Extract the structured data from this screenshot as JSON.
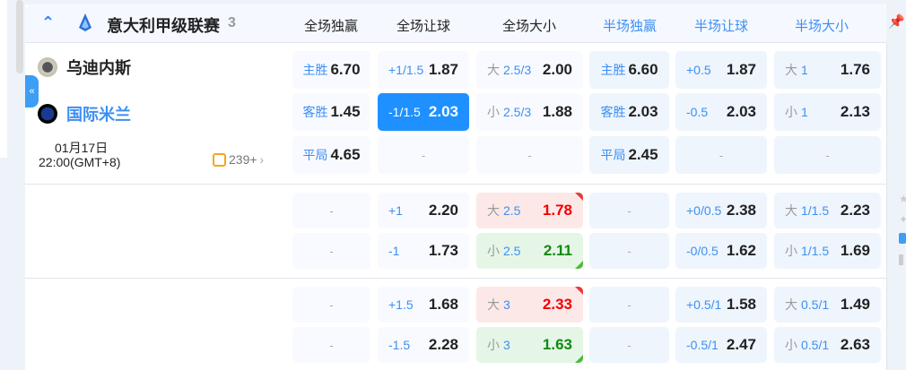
{
  "league": {
    "name": "意大利甲级联赛",
    "count": "3"
  },
  "columns": [
    "全场独赢",
    "全场让球",
    "全场大小",
    "半场独赢",
    "半场让球",
    "半场大小"
  ],
  "match": {
    "home": "乌迪内斯",
    "away": "国际米兰",
    "date": "01月17日",
    "time": "22:00(GMT+8)",
    "more_bets": "239+"
  },
  "colors": {
    "accent": "#3d8ff2",
    "selected": "#1e90ff",
    "odds_up": "#f20000",
    "odds_down": "#118a11"
  },
  "sections": [
    [
      [
        {
          "label": "主胜",
          "odds": "6.70"
        },
        {
          "line": "+1/1.5",
          "odds": "1.87"
        },
        {
          "ou": "大",
          "line": "2.5/3",
          "odds": "2.00"
        },
        {
          "label": "主胜",
          "odds": "6.60"
        },
        {
          "line": "+0.5",
          "odds": "1.87"
        },
        {
          "ou": "大",
          "line": "1",
          "odds": "1.76"
        }
      ],
      [
        {
          "label": "客胜",
          "odds": "1.45"
        },
        {
          "line": "-1/1.5",
          "odds": "2.03",
          "state": "selected"
        },
        {
          "ou": "小",
          "line": "2.5/3",
          "odds": "1.88"
        },
        {
          "label": "客胜",
          "odds": "2.03"
        },
        {
          "line": "-0.5",
          "odds": "2.03"
        },
        {
          "ou": "小",
          "line": "1",
          "odds": "2.13"
        }
      ],
      [
        {
          "label": "平局",
          "odds": "4.65"
        },
        {
          "empty": "-"
        },
        {
          "empty": "-"
        },
        {
          "label": "平局",
          "odds": "2.45"
        },
        {
          "empty": "-"
        },
        {
          "empty": "-"
        }
      ]
    ],
    [
      [
        {
          "empty": "-"
        },
        {
          "line": "+1",
          "odds": "2.20"
        },
        {
          "ou": "大",
          "line": "2.5",
          "odds": "1.78",
          "state": "up"
        },
        {
          "empty": "-"
        },
        {
          "line": "+0/0.5",
          "odds": "2.38"
        },
        {
          "ou": "大",
          "line": "1/1.5",
          "odds": "2.23"
        }
      ],
      [
        {
          "empty": "-"
        },
        {
          "line": "-1",
          "odds": "1.73"
        },
        {
          "ou": "小",
          "line": "2.5",
          "odds": "2.11",
          "state": "down"
        },
        {
          "empty": "-"
        },
        {
          "line": "-0/0.5",
          "odds": "1.62"
        },
        {
          "ou": "小",
          "line": "1/1.5",
          "odds": "1.69"
        }
      ]
    ],
    [
      [
        {
          "empty": "-"
        },
        {
          "line": "+1.5",
          "odds": "1.68"
        },
        {
          "ou": "大",
          "line": "3",
          "odds": "2.33",
          "state": "up"
        },
        {
          "empty": "-"
        },
        {
          "line": "+0.5/1",
          "odds": "1.58"
        },
        {
          "ou": "大",
          "line": "0.5/1",
          "odds": "1.49"
        }
      ],
      [
        {
          "empty": "-"
        },
        {
          "line": "-1.5",
          "odds": "2.28"
        },
        {
          "ou": "小",
          "line": "3",
          "odds": "1.63",
          "state": "down"
        },
        {
          "empty": "-"
        },
        {
          "line": "-0.5/1",
          "odds": "2.47"
        },
        {
          "ou": "小",
          "line": "0.5/1",
          "odds": "2.63"
        }
      ]
    ]
  ]
}
